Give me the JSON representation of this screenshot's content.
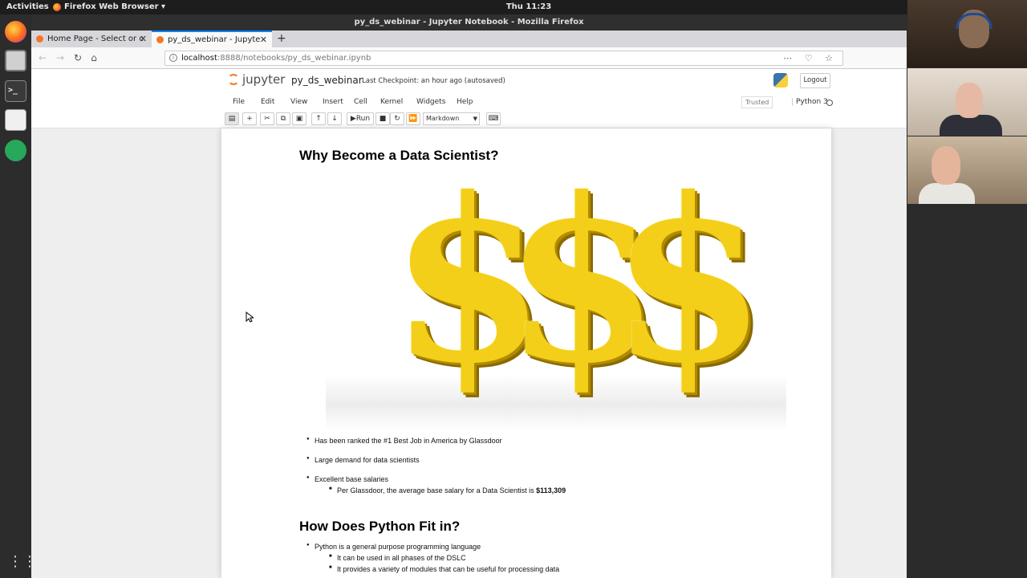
{
  "topbar": {
    "activities": "Activities",
    "app_name": "Firefox Web Browser ▾",
    "clock": "Thu 11:23"
  },
  "window": {
    "title": "py_ds_webinar - Jupyter Notebook - Mozilla Firefox"
  },
  "tabs": [
    {
      "label": "Home Page - Select or c"
    },
    {
      "label": "py_ds_webinar - Jupyte"
    }
  ],
  "urlbar": {
    "host": "localhost",
    "path": ":8888/notebooks/py_ds_webinar.ipynb"
  },
  "jupyter": {
    "logo_text": "jupyter",
    "notebook_name": "py_ds_webinar",
    "checkpoint": "Last Checkpoint: an hour ago  (autosaved)",
    "logout": "Logout",
    "menu": [
      "File",
      "Edit",
      "View",
      "Insert",
      "Cell",
      "Kernel",
      "Widgets",
      "Help"
    ],
    "trusted": "Trusted",
    "kernel_name": "Python 3",
    "toolbar": {
      "run_label": "Run",
      "cell_type": "Markdown"
    }
  },
  "notebook": {
    "heading1": "Why Become a Data Scientist?",
    "hero_glyphs": [
      "$",
      "$",
      "$"
    ],
    "bullets1": [
      "Has been ranked the #1 Best Job in America by Glassdoor",
      "Large demand for data scientists",
      "Excellent base salaries"
    ],
    "salary_sub_text": "Per Glassdoor, the average base salary for a Data Scientist is ",
    "salary_value": "$113,309",
    "heading2": "How Does Python Fit in?",
    "bullets2": [
      "Python is a general purpose programming language"
    ],
    "python_sub": [
      "It can be used in all phases of the DSLC",
      "It provides a variety of modules that can be useful for processing data"
    ]
  },
  "colors": {
    "jupyter_orange": "#f37726",
    "dollar_gold": "#f3cf1a",
    "tab_accent": "#0a84ff"
  }
}
